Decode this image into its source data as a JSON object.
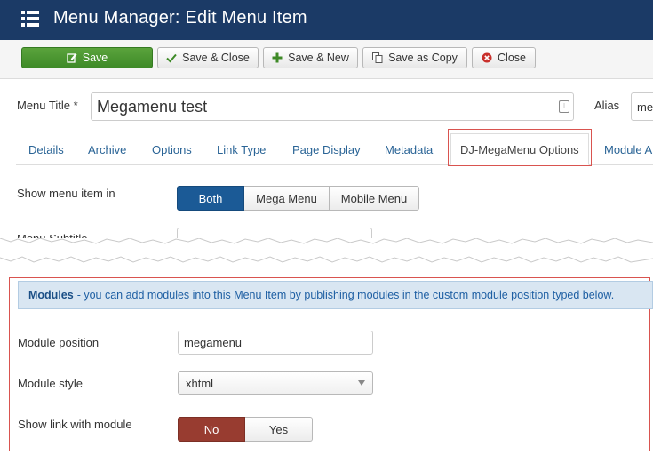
{
  "header": {
    "title": "Menu Manager: Edit Menu Item",
    "icon": "list-icon"
  },
  "toolbar": {
    "save_label": "Save",
    "save_close_label": "Save & Close",
    "save_new_label": "Save & New",
    "save_copy_label": "Save as Copy",
    "close_label": "Close"
  },
  "form": {
    "menu_title_label": "Menu Title *",
    "menu_title_value": "Megamenu test",
    "alias_label": "Alias",
    "alias_value": "me"
  },
  "tabs": [
    {
      "label": "Details"
    },
    {
      "label": "Archive"
    },
    {
      "label": "Options"
    },
    {
      "label": "Link Type"
    },
    {
      "label": "Page Display"
    },
    {
      "label": "Metadata"
    },
    {
      "label": "DJ-MegaMenu Options",
      "active": true
    },
    {
      "label": "Module A"
    }
  ],
  "show_in": {
    "label": "Show menu item in",
    "options": [
      "Both",
      "Mega Menu",
      "Mobile Menu"
    ],
    "selected": "Both"
  },
  "menu_subtitle": {
    "label": "Menu Subtitle",
    "value": ""
  },
  "modules": {
    "info_bold": "Modules",
    "info_text": "- you can add modules into this Menu Item by publishing modules in the custom module position typed below.",
    "position_label": "Module position",
    "position_value": "megamenu",
    "style_label": "Module style",
    "style_value": "xhtml",
    "show_link_label": "Show link with module",
    "show_link_options": [
      "No",
      "Yes"
    ],
    "show_link_selected": "No"
  },
  "colors": {
    "header_bg": "#1b3a66",
    "save_green": "#4a9630",
    "selected_blue": "#1b5a96",
    "selected_red": "#983c30",
    "highlight_red": "#d9534f",
    "info_bg": "#d9e6f2"
  }
}
